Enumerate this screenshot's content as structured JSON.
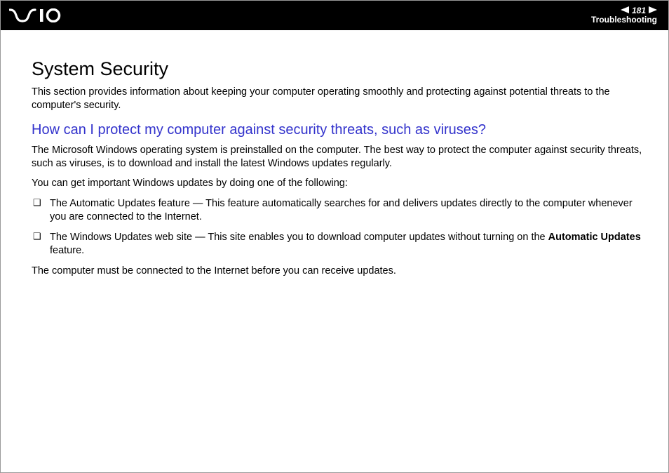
{
  "header": {
    "page_number": "181",
    "section": "Troubleshooting"
  },
  "content": {
    "title": "System Security",
    "intro": "This section provides information about keeping your computer operating smoothly and protecting against potential threats to the computer's security.",
    "question": "How can I protect my computer against security threats, such as viruses?",
    "p1": "The Microsoft Windows operating system is preinstalled on the computer. The best way to protect the computer against security threats, such as viruses, is to download and install the latest Windows updates regularly.",
    "p2": "You can get important Windows updates by doing one of the following:",
    "bullets": {
      "b1": "The Automatic Updates feature — This feature automatically searches for and delivers updates directly to the computer whenever you are connected to the Internet.",
      "b2_pre": "The Windows Updates web site — This site enables you to download computer updates without turning on the ",
      "b2_bold": "Automatic Updates",
      "b2_post": " feature."
    },
    "p3": "The computer must be connected to the Internet before you can receive updates."
  }
}
